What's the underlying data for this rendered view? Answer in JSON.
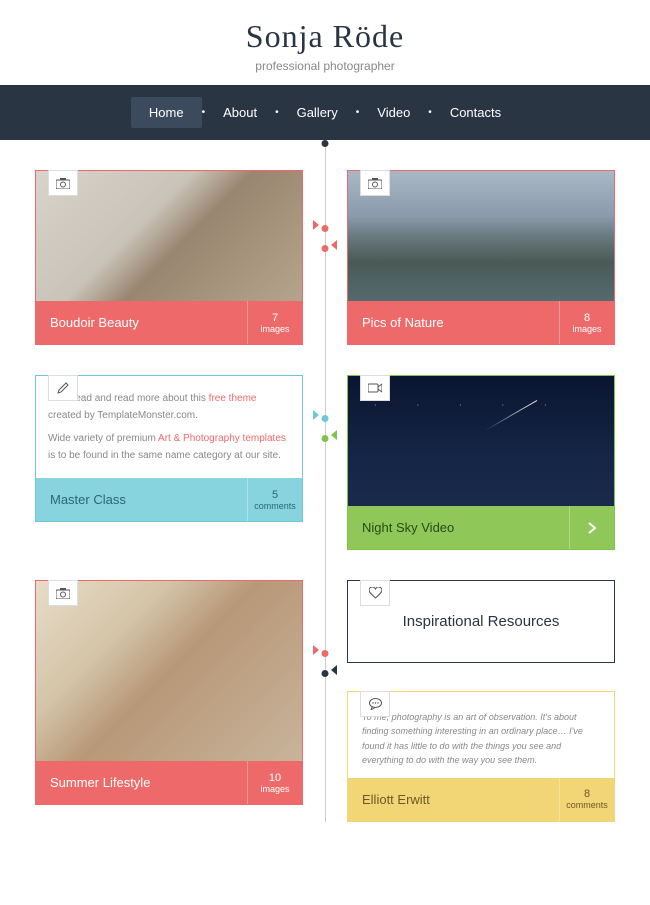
{
  "header": {
    "title": "Sonja Röde",
    "subtitle": "professional photographer"
  },
  "nav": {
    "items": [
      "Home",
      "About",
      "Gallery",
      "Video",
      "Contacts"
    ],
    "active_index": 0
  },
  "cards": {
    "boudoir": {
      "title": "Boudoir Beauty",
      "count": "7",
      "count_label": "images",
      "icon": "camera"
    },
    "nature": {
      "title": "Pics of Nature",
      "count": "8",
      "count_label": "images",
      "icon": "camera"
    },
    "master": {
      "title": "Master Class",
      "count": "5",
      "count_label": "comments",
      "icon": "pencil",
      "text_1a": "Go ahead and read more about this ",
      "text_1b": "free theme",
      "text_1c": " created by TemplateMonster.com.",
      "text_2a": "Wide variety of premium ",
      "text_2b": "Art & Photography templates",
      "text_2c": " is to be found in the same name category at our site."
    },
    "nightsky": {
      "title": "Night Sky Video",
      "icon": "video"
    },
    "summer": {
      "title": "Summer Lifestyle",
      "count": "10",
      "count_label": "images",
      "icon": "camera"
    },
    "inspire": {
      "title": "Inspirational Resources",
      "icon": "heart"
    },
    "quote": {
      "title": "Elliott Erwitt",
      "count": "8",
      "count_label": "comments",
      "icon": "speech",
      "text": "To me, photography is an art of observation. It's about finding something interesting in an ordinary place… I've found it has little to do with the things you see and everything to do with the way you see them."
    }
  }
}
